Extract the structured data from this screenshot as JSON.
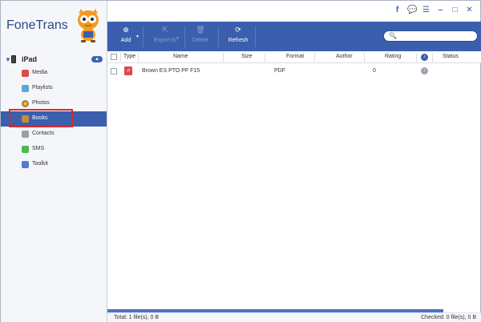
{
  "app": {
    "title": "FoneTrans"
  },
  "device": {
    "name": "iPad"
  },
  "sidebar": {
    "items": [
      {
        "label": "Media"
      },
      {
        "label": "Playlists"
      },
      {
        "label": "Photos"
      },
      {
        "label": "Books"
      },
      {
        "label": "Contacts"
      },
      {
        "label": "SMS"
      },
      {
        "label": "Toolkit"
      }
    ],
    "active": "Books"
  },
  "window_controls": {
    "facebook": "f",
    "feedback": "💬",
    "menu": "☰",
    "minimize": "–",
    "maximize": "□",
    "close": "✕"
  },
  "toolbar": {
    "add_label": "Add",
    "export_label": "Export to",
    "delete_label": "Delete",
    "refresh_label": "Refresh"
  },
  "search": {
    "placeholder": ""
  },
  "table": {
    "headers": {
      "type": "Type",
      "name": "Name",
      "size": "Size",
      "format": "Format",
      "author": "Author",
      "rating": "Rating",
      "status": "Status"
    },
    "rows": [
      {
        "name": "Brown ES PTO PF F15",
        "size": "",
        "format": "PDF",
        "author": "",
        "rating": "0",
        "status": ""
      }
    ]
  },
  "footer": {
    "total": "Total: 1 file(s), 0 B",
    "checked": "Checked: 0 file(s), 0 B"
  },
  "colors": {
    "accent": "#3b5fad",
    "highlight": "#d62a30"
  }
}
